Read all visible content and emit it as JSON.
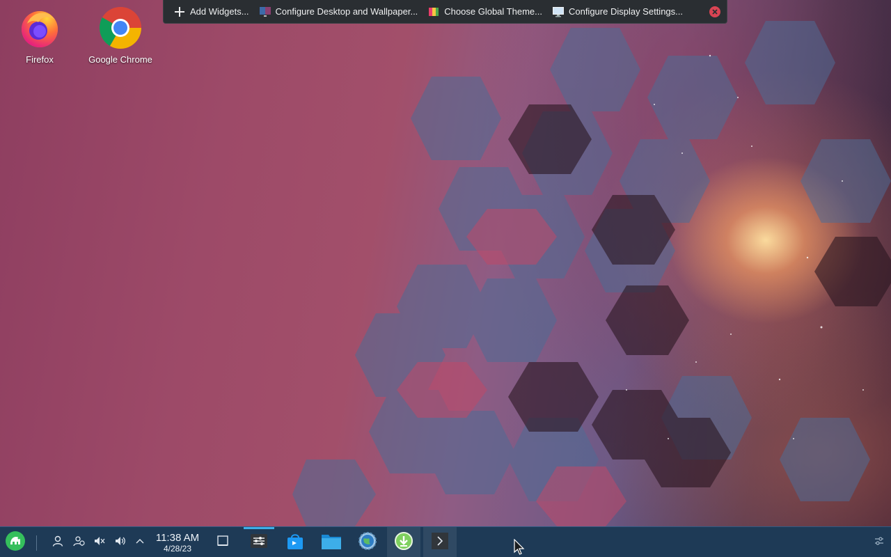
{
  "desktop": {
    "icons": [
      {
        "label": "Firefox",
        "icon": "firefox-icon"
      },
      {
        "label": "Google Chrome",
        "icon": "chrome-icon"
      }
    ]
  },
  "edit_toolbar": {
    "add_widgets": "Add Widgets...",
    "configure_desktop": "Configure Desktop and Wallpaper...",
    "choose_theme": "Choose Global Theme...",
    "configure_display": "Configure Display Settings...",
    "close_icon": "close-icon"
  },
  "panel": {
    "launcher_icon": "application-launcher-icon",
    "tray_icons": [
      "user-icon",
      "user-switch-icon",
      "microphone-muted-icon",
      "volume-icon",
      "chevron-up-icon"
    ],
    "clock": {
      "time": "11:38 AM",
      "date": "4/28/23"
    },
    "tasks": [
      "show-desktop-icon",
      "system-settings-icon",
      "discover-store-icon",
      "file-manager-icon",
      "network-globe-icon",
      "download-icon",
      "terminal-icon"
    ],
    "config_icon": "panel-settings-icon"
  },
  "colors": {
    "panel_bg": "#1e3a56",
    "toolbar_bg": "#2a2e32",
    "accent": "#3daee9",
    "close_red": "#da4453"
  }
}
